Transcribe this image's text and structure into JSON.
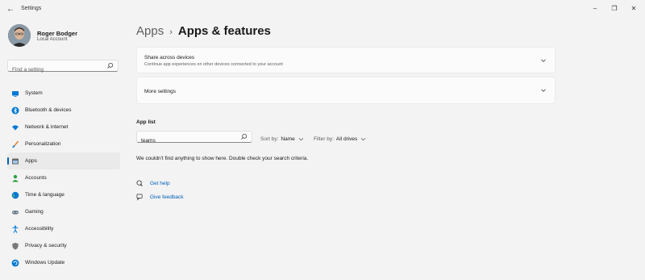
{
  "window": {
    "title": "Settings",
    "controls": {
      "minimize": "–",
      "maximize": "❐",
      "close": "✕"
    }
  },
  "user": {
    "name": "Roger Bodger",
    "account_type": "Local Account"
  },
  "sidebar": {
    "search_placeholder": "Find a setting",
    "items": [
      {
        "label": "System",
        "icon": "monitor-icon",
        "color": "#0078d4"
      },
      {
        "label": "Bluetooth & devices",
        "icon": "bluetooth-icon",
        "color": "#0078d4"
      },
      {
        "label": "Network & internet",
        "icon": "wifi-icon",
        "color": "#0078d4"
      },
      {
        "label": "Personalization",
        "icon": "brush-icon",
        "color": "#e67e22"
      },
      {
        "label": "Apps",
        "icon": "apps-icon",
        "color": "#555555",
        "active": true
      },
      {
        "label": "Accounts",
        "icon": "person-icon",
        "color": "#2ea043"
      },
      {
        "label": "Time & language",
        "icon": "globe-clock-icon",
        "color": "#0078d4"
      },
      {
        "label": "Gaming",
        "icon": "gamepad-icon",
        "color": "#6b7b8c"
      },
      {
        "label": "Accessibility",
        "icon": "accessibility-icon",
        "color": "#0078d4"
      },
      {
        "label": "Privacy & security",
        "icon": "shield-icon",
        "color": "#7a7a7a"
      },
      {
        "label": "Windows Update",
        "icon": "update-icon",
        "color": "#0078d4"
      }
    ]
  },
  "breadcrumb": {
    "parent": "Apps",
    "separator": "›",
    "current": "Apps & features"
  },
  "cards": {
    "share": {
      "title": "Share across devices",
      "description": "Continue app experiences on other devices connected to your account"
    },
    "more": {
      "title": "More settings"
    }
  },
  "app_list": {
    "label": "App list",
    "search_value": "teams",
    "sort_label": "Sort by:",
    "sort_value": "Name",
    "filter_label": "Filter by:",
    "filter_value": "All drives",
    "empty_message": "We couldn't find anything to show here. Double check your search criteria."
  },
  "links": {
    "get_help": "Get help",
    "give_feedback": "Give feedback"
  },
  "colors": {
    "accent": "#005fb8",
    "background": "#f3f3f3",
    "card": "#fbfbfb"
  }
}
